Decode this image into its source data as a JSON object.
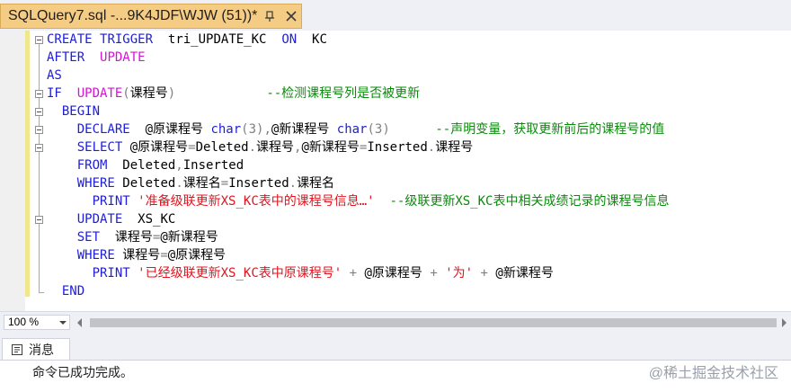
{
  "tab": {
    "title": "SQLQuery7.sql -...9K4JDF\\WJW (51))*",
    "pin_icon": "pin-icon",
    "close_icon": "close-icon"
  },
  "editor": {
    "lines": [
      [
        {
          "t": "CREATE",
          "c": "kw"
        },
        {
          "t": " "
        },
        {
          "t": "TRIGGER",
          "c": "kw"
        },
        {
          "t": "  tri_UPDATE_KC  "
        },
        {
          "t": "ON",
          "c": "kw"
        },
        {
          "t": "  KC"
        }
      ],
      [
        {
          "t": "AFTER",
          "c": "kw"
        },
        {
          "t": "  "
        },
        {
          "t": "UPDATE",
          "c": "fn"
        }
      ],
      [
        {
          "t": "AS",
          "c": "kw"
        }
      ],
      [
        {
          "t": "IF",
          "c": "kw"
        },
        {
          "t": "  "
        },
        {
          "t": "UPDATE",
          "c": "fn"
        },
        {
          "t": "(",
          "c": "gray"
        },
        {
          "t": "课程号"
        },
        {
          "t": ")",
          "c": "gray"
        },
        {
          "t": "            "
        },
        {
          "t": "--检测课程号列是否被更新",
          "c": "cmt"
        }
      ],
      [
        {
          "t": "  "
        },
        {
          "t": "BEGIN",
          "c": "kw"
        }
      ],
      [
        {
          "t": "    "
        },
        {
          "t": "DECLARE",
          "c": "kw"
        },
        {
          "t": "  @原课程号 "
        },
        {
          "t": "char",
          "c": "kw"
        },
        {
          "t": "(3)",
          "c": "gray"
        },
        {
          "t": ",",
          "c": "gray"
        },
        {
          "t": "@新课程号 "
        },
        {
          "t": "char",
          "c": "kw"
        },
        {
          "t": "(3)",
          "c": "gray"
        },
        {
          "t": "      "
        },
        {
          "t": "--声明变量，获取更新前后的课程号的值",
          "c": "cmt"
        }
      ],
      [
        {
          "t": "    "
        },
        {
          "t": "SELECT",
          "c": "kw"
        },
        {
          "t": " @原课程号"
        },
        {
          "t": "=",
          "c": "gray"
        },
        {
          "t": "Deleted"
        },
        {
          "t": ".",
          "c": "gray"
        },
        {
          "t": "课程号"
        },
        {
          "t": ",",
          "c": "gray"
        },
        {
          "t": "@新课程号"
        },
        {
          "t": "=",
          "c": "gray"
        },
        {
          "t": "Inserted"
        },
        {
          "t": ".",
          "c": "gray"
        },
        {
          "t": "课程号"
        }
      ],
      [
        {
          "t": "    "
        },
        {
          "t": "FROM",
          "c": "kw"
        },
        {
          "t": "  Deleted"
        },
        {
          "t": ",",
          "c": "gray"
        },
        {
          "t": "Inserted"
        }
      ],
      [
        {
          "t": "    "
        },
        {
          "t": "WHERE",
          "c": "kw"
        },
        {
          "t": " Deleted"
        },
        {
          "t": ".",
          "c": "gray"
        },
        {
          "t": "课程名"
        },
        {
          "t": "=",
          "c": "gray"
        },
        {
          "t": "Inserted"
        },
        {
          "t": ".",
          "c": "gray"
        },
        {
          "t": "课程名"
        }
      ],
      [
        {
          "t": "      "
        },
        {
          "t": "PRINT",
          "c": "kw"
        },
        {
          "t": " "
        },
        {
          "t": "'准备级联更新XS_KC表中的课程号信息…'",
          "c": "str"
        },
        {
          "t": "  "
        },
        {
          "t": "--级联更新XS_KC表中相关成绩记录的课程号信息",
          "c": "cmt"
        }
      ],
      [
        {
          "t": "    "
        },
        {
          "t": "UPDATE",
          "c": "kw"
        },
        {
          "t": "  XS_KC"
        }
      ],
      [
        {
          "t": "    "
        },
        {
          "t": "SET",
          "c": "kw"
        },
        {
          "t": "  课程号"
        },
        {
          "t": "=",
          "c": "gray"
        },
        {
          "t": "@新课程号"
        }
      ],
      [
        {
          "t": "    "
        },
        {
          "t": "WHERE",
          "c": "kw"
        },
        {
          "t": " 课程号"
        },
        {
          "t": "=",
          "c": "gray"
        },
        {
          "t": "@原课程号"
        }
      ],
      [
        {
          "t": "      "
        },
        {
          "t": "PRINT",
          "c": "kw"
        },
        {
          "t": " "
        },
        {
          "t": "'已经级联更新XS_KC表中原课程号'",
          "c": "str"
        },
        {
          "t": " "
        },
        {
          "t": "+",
          "c": "gray"
        },
        {
          "t": " @原课程号 "
        },
        {
          "t": "+",
          "c": "gray"
        },
        {
          "t": " "
        },
        {
          "t": "'为'",
          "c": "str"
        },
        {
          "t": " "
        },
        {
          "t": "+",
          "c": "gray"
        },
        {
          "t": " @新课程号"
        }
      ],
      [
        {
          "t": "  "
        },
        {
          "t": "END",
          "c": "kw"
        }
      ]
    ]
  },
  "status": {
    "zoom": "100 %"
  },
  "results": {
    "tab_label": "消息",
    "message": "命令已成功完成。",
    "watermark": "@稀土掘金技术社区"
  },
  "colors": {
    "tab_active": "#f5cc84",
    "keyword": "#1e1ed6",
    "function": "#d414d4",
    "string": "#e0141e",
    "comment": "#0a8a0a",
    "change_bar": "#f0e68c"
  }
}
